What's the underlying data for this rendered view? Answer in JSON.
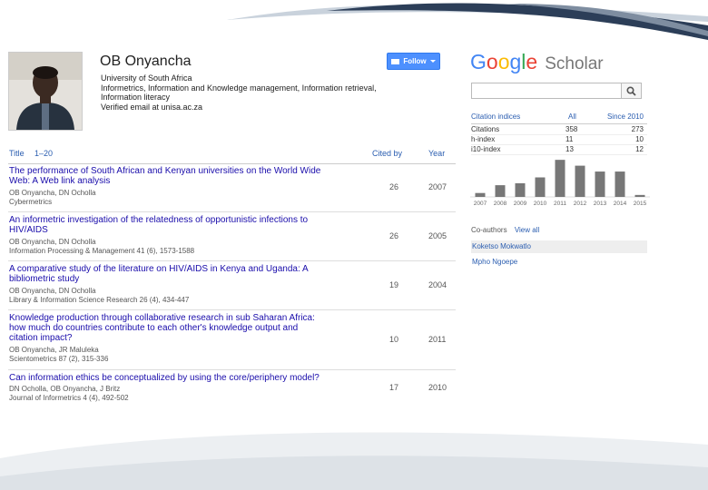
{
  "profile": {
    "name": "OB Onyancha",
    "affiliation": "University of South Africa",
    "interests_line1": "Informetrics, Information and Knowledge management, Information retrieval,",
    "interests_line2": "Information literacy",
    "email": "Verified email at unisa.ac.za",
    "follow_label": "Follow"
  },
  "table": {
    "title_label": "Title",
    "range_label": "1–20",
    "cited_label": "Cited by",
    "year_label": "Year",
    "rows": [
      {
        "title1": "The performance of South African and Kenyan universities on the World Wide",
        "title2": "Web: A Web link analysis",
        "authors": "OB Onyancha, DN Ocholla",
        "venue": "Cybermetrics",
        "cited": "26",
        "year": "2007"
      },
      {
        "title1": "An informetric investigation of the relatedness of opportunistic infections to",
        "title2": "HIV/AIDS",
        "authors": "OB Onyancha, DN Ocholla",
        "venue": "Information Processing & Management 41 (6), 1573-1588",
        "cited": "26",
        "year": "2005"
      },
      {
        "title1": "A comparative study of the literature on HIV/AIDS in Kenya and Uganda: A",
        "title2": "bibliometric study",
        "authors": "OB Onyancha, DN Ocholla",
        "venue": "Library & Information Science Research 26 (4), 434-447",
        "cited": "19",
        "year": "2004"
      },
      {
        "title1": "Knowledge production through collaborative research in sub Saharan Africa:",
        "title2": "how much do countries contribute to each other's knowledge output and",
        "title3": "citation impact?",
        "authors": "OB Onyancha, JR Maluleka",
        "venue": "Scientometrics 87 (2), 315-336",
        "cited": "10",
        "year": "2011"
      },
      {
        "title1": "Can information ethics be conceptualized by using the core/periphery model?",
        "authors": "DN Ocholla, OB Onyancha, J Britz",
        "venue": "Journal of Informetrics 4 (4), 492-502",
        "cited": "17",
        "year": "2010"
      }
    ]
  },
  "scholar": {
    "logo_letters": [
      "G",
      "o",
      "o",
      "g",
      "l",
      "e"
    ],
    "logo_word": "Scholar",
    "search_icon": "magnifier-icon"
  },
  "citation_indices": {
    "header": "Citation indices",
    "all_label": "All",
    "since_label": "Since 2010",
    "rows": [
      {
        "label": "Citations",
        "all": "358",
        "since": "273"
      },
      {
        "label": "h-index",
        "all": "11",
        "since": "10"
      },
      {
        "label": "i10-index",
        "all": "13",
        "since": "12"
      }
    ]
  },
  "chart_data": {
    "type": "bar",
    "categories": [
      "2007",
      "2008",
      "2009",
      "2010",
      "2011",
      "2012",
      "2013",
      "2014",
      "2015"
    ],
    "values": [
      4,
      12,
      14,
      20,
      38,
      32,
      26,
      26,
      2
    ],
    "ylim": [
      0,
      40
    ],
    "bar_color": "#777777"
  },
  "coauthors": {
    "header": "Co-authors",
    "view_all": "View all",
    "items": [
      "Koketso Mokwatlo",
      "Mpho Ngoepe"
    ]
  },
  "colors": {
    "link": "#1a0dab",
    "accent_blue": "#4d90fe",
    "swoosh": "#2c3e58"
  }
}
